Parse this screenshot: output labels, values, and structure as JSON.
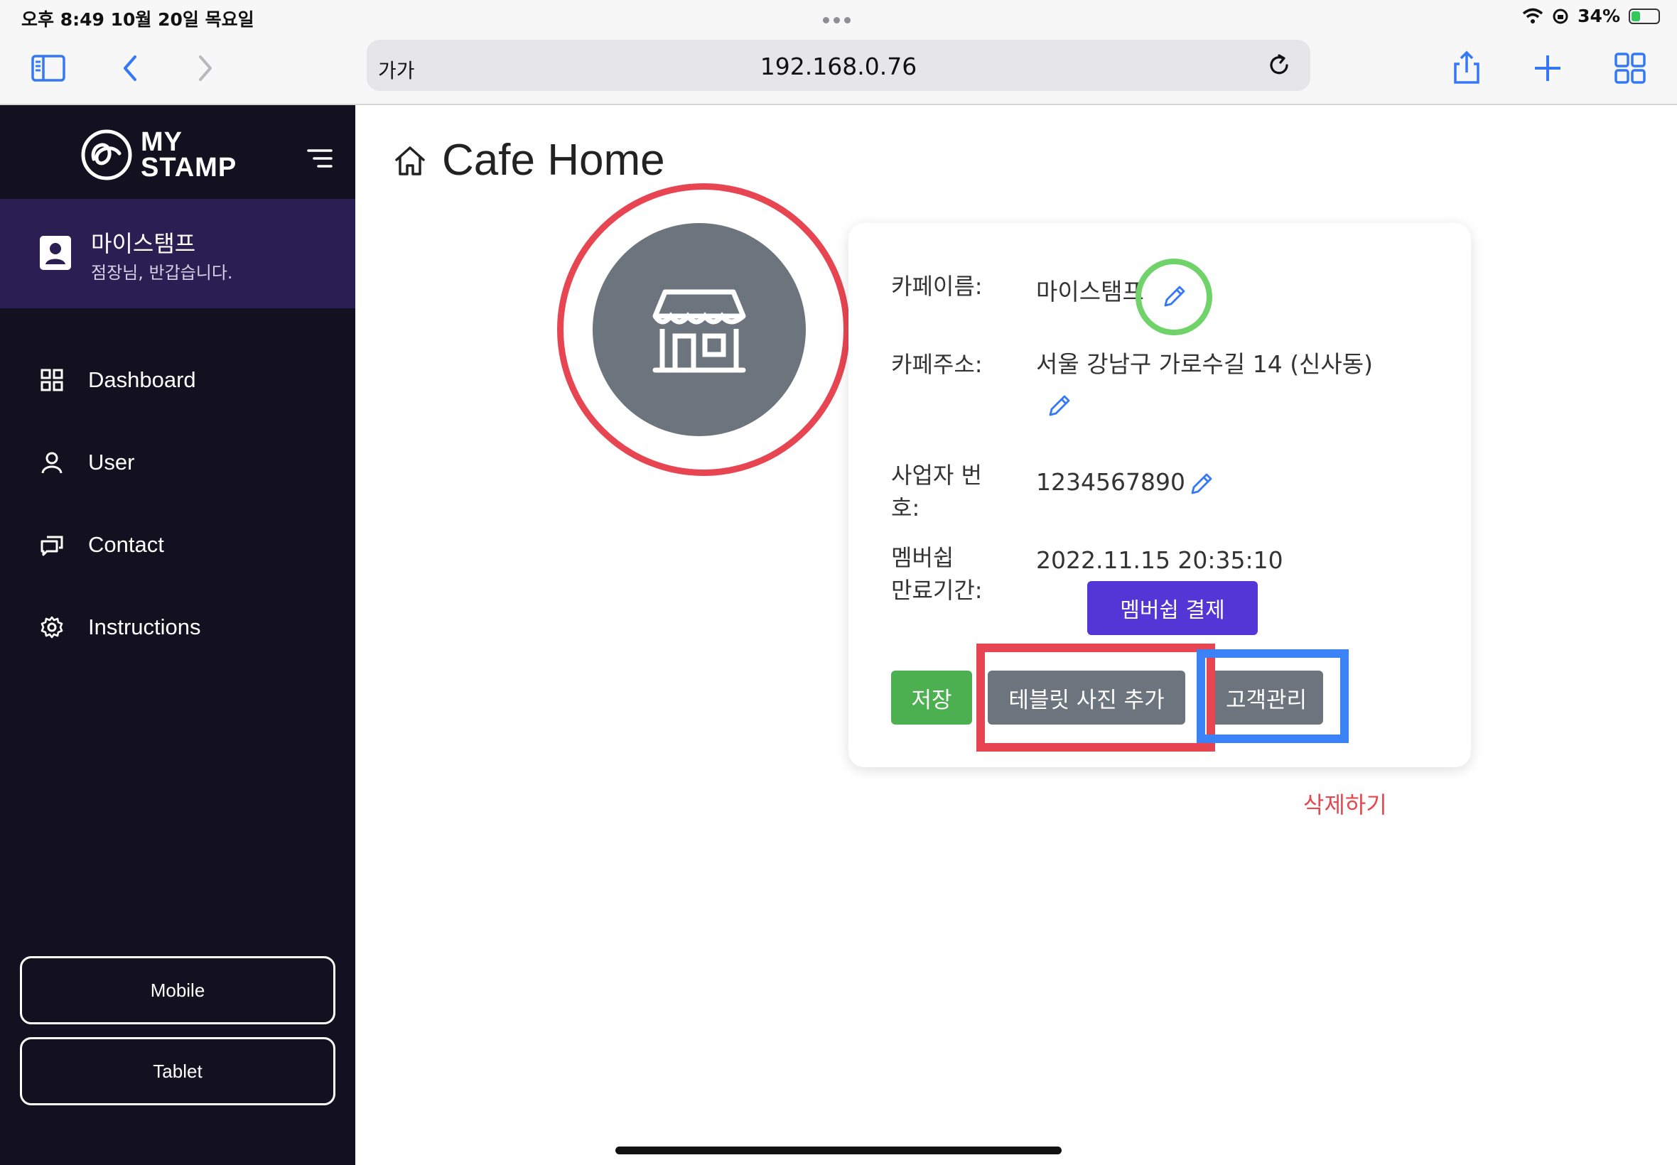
{
  "status_bar": {
    "time_date": "오후 8:49   10월 20일 목요일",
    "battery": "34%",
    "battery_level": 0.34
  },
  "browser": {
    "text_size_label": "가가",
    "url": "192.168.0.76"
  },
  "sidebar": {
    "logo_line1": "MY",
    "logo_line2": "STAMP",
    "profile_name": "마이스탬프",
    "profile_greeting": "점장님, 반갑습니다.",
    "nav": [
      {
        "label": "Dashboard",
        "icon": "grid-icon"
      },
      {
        "label": "User",
        "icon": "user-icon"
      },
      {
        "label": "Contact",
        "icon": "chat-icon"
      },
      {
        "label": "Instructions",
        "icon": "gear-icon"
      }
    ],
    "buttons": {
      "mobile": "Mobile",
      "tablet": "Tablet"
    }
  },
  "main": {
    "title": "Cafe Home",
    "fields": {
      "cafe_name_label": "카페이름:",
      "cafe_name_value": "마이스탬프",
      "address_label": "카페주소:",
      "address_value": "서울 강남구 가로수길 14 (신사동)",
      "biz_label_1": "사업자 번",
      "biz_label_2": "호:",
      "biz_value": "1234567890",
      "membership_label_1": "멤버쉽",
      "membership_label_2": "만료기간:",
      "membership_value": "2022.11.15 20:35:10"
    },
    "buttons": {
      "pay": "멤버쉽 결제",
      "save": "저장",
      "add_tablet_photo": "테블릿 사진 추가",
      "customer_mgmt": "고객관리",
      "delete": "삭제하기"
    }
  },
  "colors": {
    "sidebar_bg": "#13101f",
    "profile_bg": "#2a1f52",
    "accent_purple": "#5236d6",
    "save_green": "#4caf50",
    "secondary_gray": "#6c757d",
    "delete_red": "#e5484d",
    "annotation_red": "#e84552",
    "annotation_blue": "#3b82f6",
    "annotation_green": "#6fd36a"
  }
}
